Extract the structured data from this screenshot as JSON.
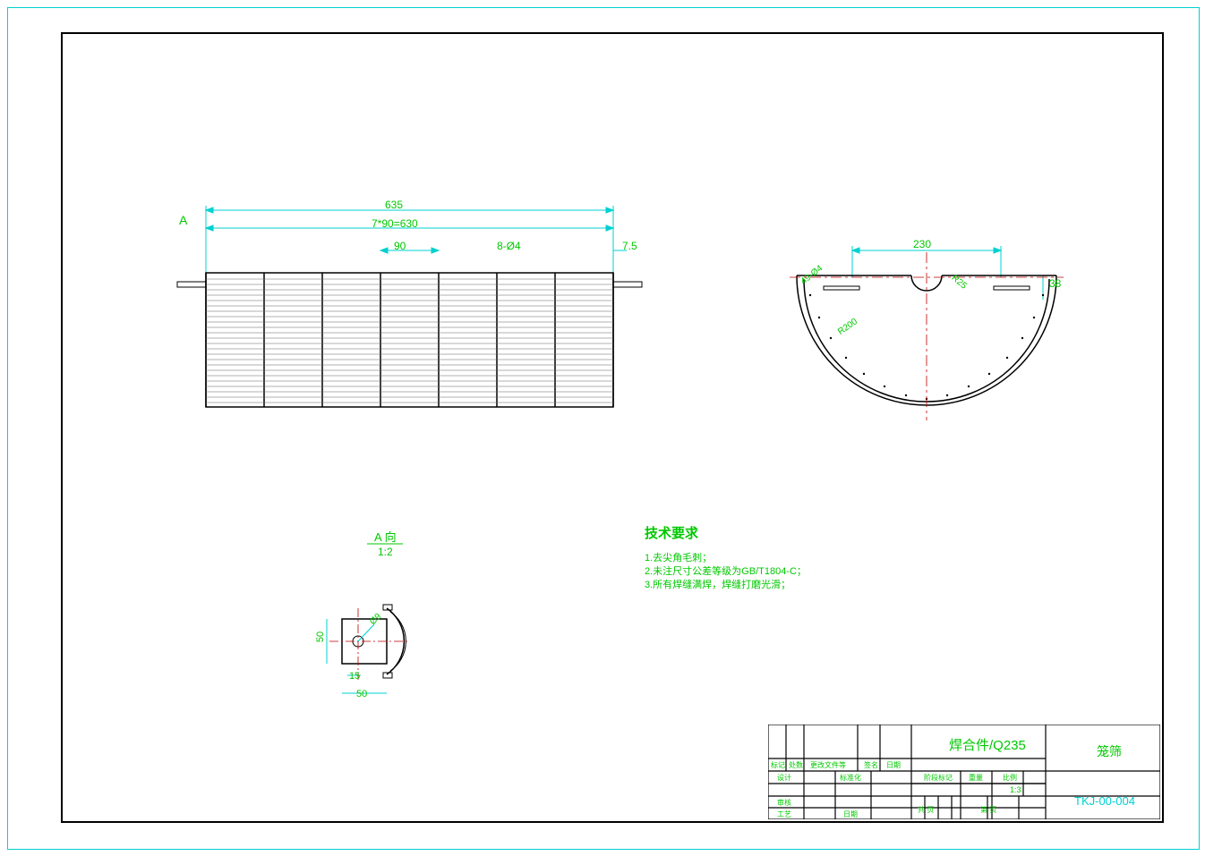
{
  "dimensions": {
    "top_main": "635",
    "top_sub": "7*90=630",
    "spacing": "90",
    "hole_count": "8-Ø4",
    "right_gap": "7.5",
    "view_marker": "A",
    "side_width": "230",
    "side_height": "38",
    "side_hole": "49-Ø4",
    "side_radius1": "R25",
    "side_radius2": "R200",
    "detail_title": "A 向",
    "detail_scale": "1:2",
    "detail_dia": "Ø9",
    "detail_15": "15",
    "detail_50": "50",
    "detail_50v": "50"
  },
  "notes": {
    "title": "技术要求",
    "line1": "1.去尖角毛刺；",
    "line2": "2.未注尺寸公差等级为GB/T1804-C；",
    "line3": "3.所有焊缝满焊，焊缝打磨光滑；"
  },
  "title_block": {
    "material": "焊合件/Q235",
    "col1_l": "标记",
    "col1_r": "处数",
    "col2": "更改文件等",
    "col3": "签名",
    "col4": "日期",
    "row_design": "设计",
    "row_std": "标准化",
    "row_check": "审核",
    "row_appr": "工艺",
    "row_date": "日期",
    "stage": "阶段标记",
    "weight": "重量",
    "scale": "比例",
    "scale_val": "1:3",
    "sheet1": "共  页",
    "sheet2": "第  页",
    "part_name": "笼筛",
    "drawing_no": "TKJ-00-004"
  }
}
